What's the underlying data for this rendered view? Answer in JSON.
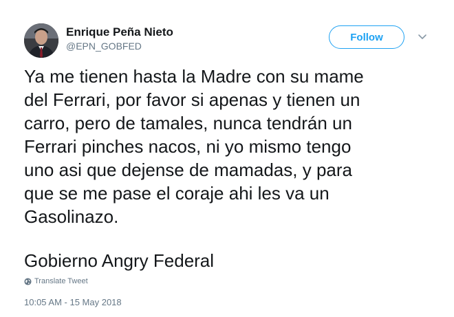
{
  "author": {
    "display_name": "Enrique Peña Nieto",
    "handle": "@EPN_GOBFED",
    "avatar_icon": "profile-photo"
  },
  "actions": {
    "follow_label": "Follow",
    "menu_icon": "chevron-down-icon"
  },
  "tweet": {
    "lines": [
      "Ya me tienen hasta la Madre con su mame",
      "del Ferrari, por favor si apenas y tienen un",
      "carro, pero de tamales, nunca tendrán un",
      "Ferrari pinches nacos, ni yo mismo tengo",
      "uno asi que dejense de mamadas, y para",
      "que se me pase el coraje ahi les va un",
      "Gasolinazo."
    ],
    "signature": "Gobierno Angry Federal"
  },
  "translate_label": "Translate Tweet",
  "timestamp": "10:05 AM - 15 May 2018",
  "colors": {
    "accent": "#1da1f2",
    "text": "#14171a",
    "muted": "#657786"
  }
}
